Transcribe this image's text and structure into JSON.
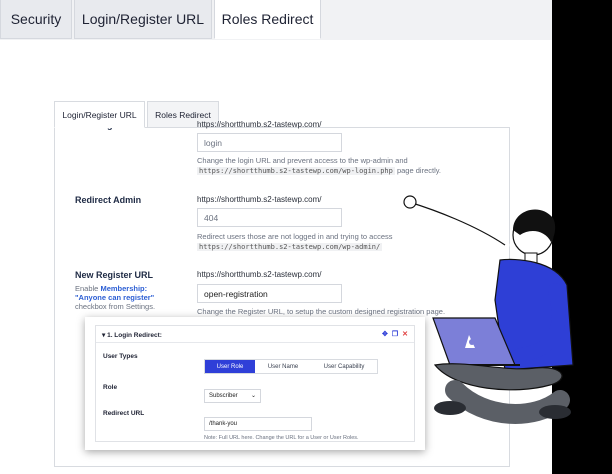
{
  "top_tabs": [
    {
      "label": "Security"
    },
    {
      "label": "Login/Register URL"
    },
    {
      "label": "Roles Redirect"
    }
  ],
  "inner_tabs": [
    {
      "label": "Login/Register URL"
    },
    {
      "label": "Roles Redirect"
    }
  ],
  "fields": {
    "login": {
      "label": "New Login URL",
      "base_url": "https://shortthumb.s2-tastewp.com/",
      "placeholder": "login",
      "help_prefix": "Change the login URL and prevent access to the wp-admin and",
      "help_code": "https://shortthumb.s2-tastewp.com/wp-login.php",
      "help_suffix": "page directly."
    },
    "admin": {
      "label": "Redirect Admin",
      "base_url": "https://shortthumb.s2-tastewp.com/",
      "placeholder": "404",
      "help_prefix": "Redirect users those are not logged in and trying to access",
      "help_code": "https://shortthumb.s2-tastewp.com/wp-admin/"
    },
    "register": {
      "label": "New Register URL",
      "note_prefix": "Enable",
      "note_link": "Membership:",
      "note_highlight": "\"Anyone can register\"",
      "note_suffix": "checkbox from Settings.",
      "base_url": "https://shortthumb.s2-tastewp.com/",
      "value": "open-registration",
      "help": "Change the Register URL, to setup the custom designed registration page."
    }
  },
  "card": {
    "title": "1. Login Redirect:",
    "user_types_label": "User Types",
    "segments": [
      "User Role",
      "User Name",
      "User Capability"
    ],
    "role_label": "Role",
    "role_value": "Subscriber",
    "redirect_label": "Redirect URL",
    "redirect_value": "/thank-you",
    "note": "Note: Full URL here. Change the URL for a User or User Roles."
  },
  "colors": {
    "accent": "#2f3fd8",
    "person_shirt": "#2e3fd6",
    "person_pants": "#5b5f66",
    "laptop": "#7c7fd8"
  }
}
